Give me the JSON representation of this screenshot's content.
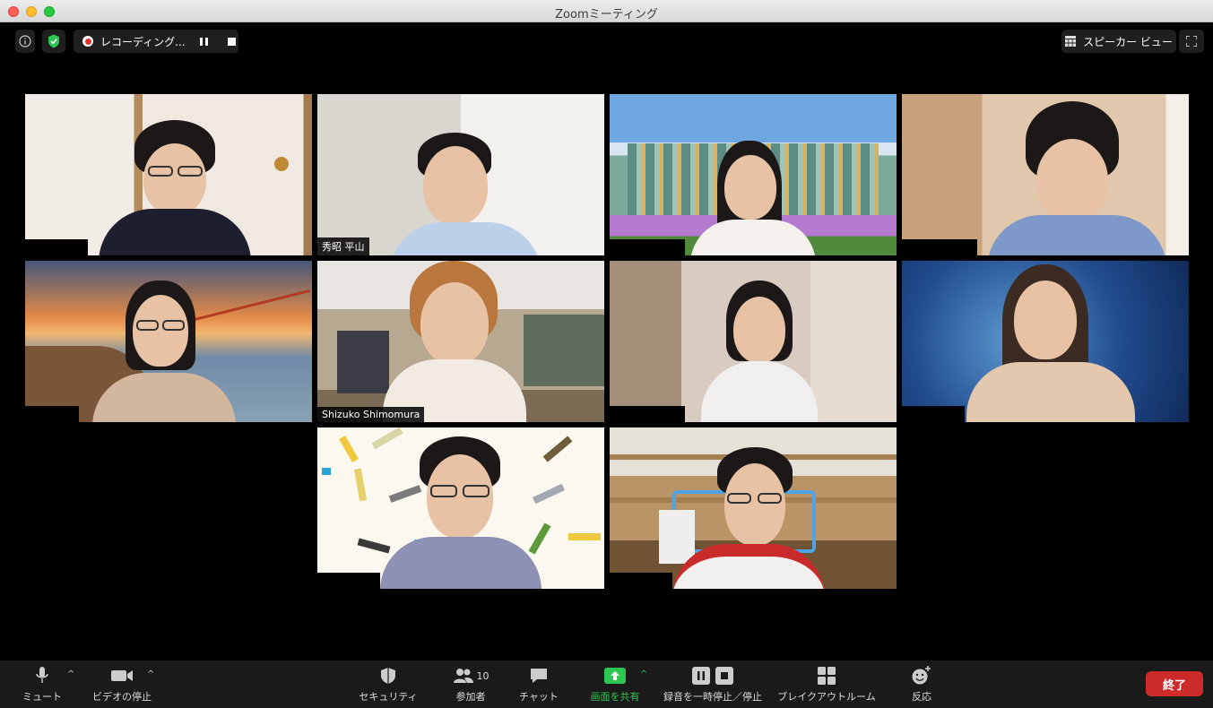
{
  "window": {
    "title": "Zoomミーティング"
  },
  "top_bar": {
    "info_icon": "info-icon",
    "security_icon": "shield-check-icon",
    "recording_label": "レコーディング...",
    "view_label": "スピーカー ビュー",
    "fullscreen_icon": "fullscreen-icon"
  },
  "participants": [
    {
      "name": ""
    },
    {
      "name": "秀昭 平山"
    },
    {
      "name": ""
    },
    {
      "name": ""
    },
    {
      "name": ""
    },
    {
      "name": "Shizuko Shimomura"
    },
    {
      "name": ""
    },
    {
      "name": ""
    },
    {
      "name": ""
    },
    {
      "name": ""
    }
  ],
  "toolbar": {
    "mute_label": "ミュート",
    "video_label": "ビデオの停止",
    "security_label": "セキュリティ",
    "participants_label": "参加者",
    "participants_count": "10",
    "chat_label": "チャット",
    "share_label": "画面を共有",
    "record_label": "録音を一時停止／停止",
    "breakout_label": "ブレイクアウトルーム",
    "reactions_label": "反応",
    "end_label": "終了"
  },
  "colors": {
    "share_green": "#2dc653",
    "end_red": "#cd2a2a"
  }
}
